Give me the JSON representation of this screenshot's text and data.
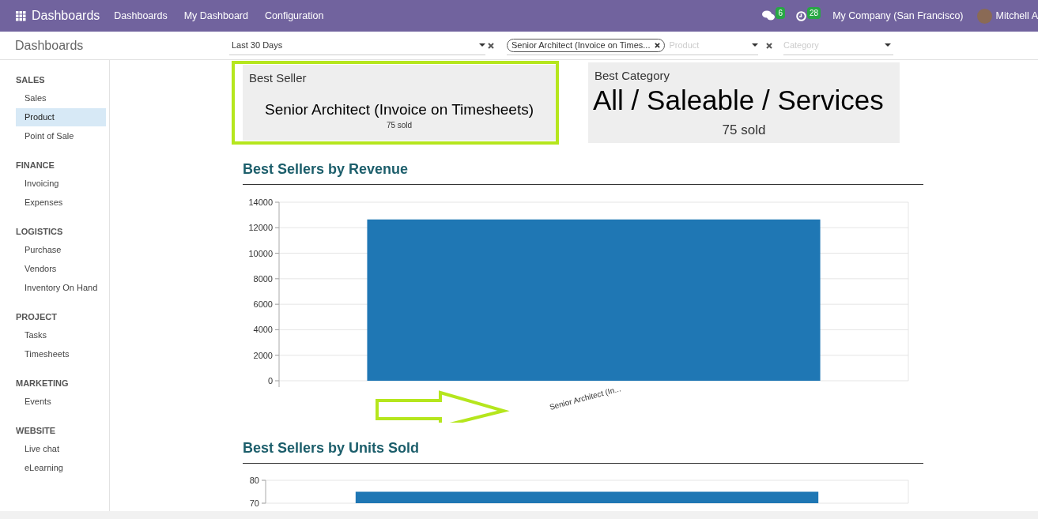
{
  "navbar": {
    "app_title": "Dashboards",
    "menu": [
      "Dashboards",
      "My Dashboard",
      "Configuration"
    ],
    "messages_count": "6",
    "activities_count": "28",
    "company": "My Company (San Francisco)",
    "user": "Mitchell A"
  },
  "control_panel": {
    "title": "Dashboards",
    "date_filter": {
      "value": "Last 30 Days"
    },
    "product_filter": {
      "tag": "Senior Architect (Invoice on Times...",
      "placeholder": "Product"
    },
    "category_filter": {
      "placeholder": "Category"
    }
  },
  "sidebar": [
    {
      "heading": "SALES",
      "items": [
        {
          "label": "Sales",
          "selected": false
        },
        {
          "label": "Product",
          "selected": true
        },
        {
          "label": "Point of Sale",
          "selected": false
        }
      ]
    },
    {
      "heading": "FINANCE",
      "items": [
        {
          "label": "Invoicing",
          "selected": false
        },
        {
          "label": "Expenses",
          "selected": false
        }
      ]
    },
    {
      "heading": "LOGISTICS",
      "items": [
        {
          "label": "Purchase",
          "selected": false
        },
        {
          "label": "Vendors",
          "selected": false
        },
        {
          "label": "Inventory On Hand",
          "selected": false
        }
      ]
    },
    {
      "heading": "PROJECT",
      "items": [
        {
          "label": "Tasks",
          "selected": false
        },
        {
          "label": "Timesheets",
          "selected": false
        }
      ]
    },
    {
      "heading": "MARKETING",
      "items": [
        {
          "label": "Events",
          "selected": false
        }
      ]
    },
    {
      "heading": "WEBSITE",
      "items": [
        {
          "label": "Live chat",
          "selected": false
        },
        {
          "label": "eLearning",
          "selected": false
        }
      ]
    }
  ],
  "cards": [
    {
      "title": "Best Seller",
      "value": "Senior Architect (Invoice on Timesheets)",
      "caption": "75 sold",
      "highlighted": true,
      "kind": "small"
    },
    {
      "title": "Best Category",
      "value": "All / Saleable / Services",
      "caption": "75 sold",
      "highlighted": false,
      "kind": "large"
    }
  ],
  "sections": [
    {
      "title": "Best Sellers by Revenue",
      "chart_data": {
        "type": "bar",
        "categories": [
          "Senior Architect (In..."
        ],
        "grid": true,
        "series": [
          {
            "color": "#1f77b4",
            "values": [
              12650
            ]
          }
        ],
        "ylim": [
          0,
          14000
        ],
        "yticks": [
          0,
          2000,
          4000,
          6000,
          8000,
          10000,
          12000,
          14000
        ]
      }
    },
    {
      "title": "Best Sellers by Units Sold",
      "chart_data": {
        "type": "bar",
        "categories": [
          null
        ],
        "grid": true,
        "series": [
          {
            "color": "#1f77b4",
            "values": [
              75
            ]
          }
        ],
        "ylim": [
          70,
          80
        ],
        "yticks": [
          70,
          80
        ]
      }
    }
  ]
}
